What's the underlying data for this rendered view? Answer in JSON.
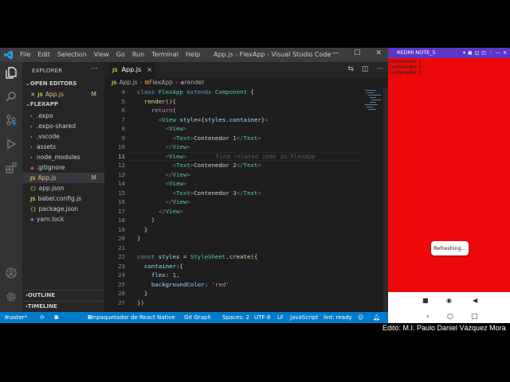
{
  "titlebar": {
    "menu": [
      "File",
      "Edit",
      "Selection",
      "View",
      "Go",
      "Run",
      "Terminal",
      "Help"
    ],
    "window_title": "App.js - FlexApp - Visual Studio Code",
    "minimize": "—",
    "maximize": "☐",
    "close": "✕"
  },
  "sidebar": {
    "title": "EXPLORER",
    "more": "···",
    "open_editors_label": "OPEN EDITORS",
    "open_editor_file": "App.js",
    "open_editor_badge": "M",
    "project_label": "FLEXAPP",
    "items": [
      {
        "label": ".expo",
        "type": "folder"
      },
      {
        "label": ".expo-shared",
        "type": "folder"
      },
      {
        "label": ".vscode",
        "type": "folder"
      },
      {
        "label": "assets",
        "type": "folder"
      },
      {
        "label": "node_modules",
        "type": "folder"
      },
      {
        "label": ".gitignore",
        "type": "file"
      },
      {
        "label": "App.js",
        "type": "file",
        "badge": "M"
      },
      {
        "label": "app.json",
        "type": "file"
      },
      {
        "label": "babel.config.js",
        "type": "file"
      },
      {
        "label": "package.json",
        "type": "file"
      },
      {
        "label": "yarn.lock",
        "type": "file"
      }
    ],
    "outline_label": "OUTLINE",
    "timeline_label": "TIMELINE"
  },
  "tabs": {
    "active": "App.js",
    "close": "×"
  },
  "breadcrumb": {
    "file": "App.js",
    "class": "FlexApp",
    "method": "render"
  },
  "editor": {
    "lines": [
      {
        "n": "4",
        "text": "class FlexApp extends Component {"
      },
      {
        "n": "5",
        "text": "  render(){"
      },
      {
        "n": "6",
        "text": "    return("
      },
      {
        "n": "7",
        "text": "      <View style={styles.container}>"
      },
      {
        "n": "8",
        "text": "        <View>"
      },
      {
        "n": "9",
        "text": "          <Text>Contenedor 1</Text>"
      },
      {
        "n": "10",
        "text": "        </View>"
      },
      {
        "n": "11",
        "text": "        <View>"
      },
      {
        "n": "12",
        "text": "          <Text>Contenedor 2</Text>"
      },
      {
        "n": "13",
        "text": "        </View>"
      },
      {
        "n": "14",
        "text": "        <View>"
      },
      {
        "n": "15",
        "text": "          <Text>Contenedor 3</Text>"
      },
      {
        "n": "16",
        "text": "        </View>"
      },
      {
        "n": "17",
        "text": "      </View>"
      },
      {
        "n": "18",
        "text": "    )"
      },
      {
        "n": "19",
        "text": "  }"
      },
      {
        "n": "20",
        "text": "}"
      },
      {
        "n": "21",
        "text": ""
      },
      {
        "n": "22",
        "text": "const styles = StyleSheet.create({"
      },
      {
        "n": "23",
        "text": "  container:{"
      },
      {
        "n": "24",
        "text": "    flex: 1,"
      },
      {
        "n": "25",
        "text": "    backgroundColor: 'red'"
      },
      {
        "n": "26",
        "text": "  }"
      },
      {
        "n": "27",
        "text": "})"
      }
    ],
    "ghost_hint": "Find related code in FlexApp"
  },
  "statusbar": {
    "branch": "master*",
    "errors": "0",
    "warnings": "0",
    "extension": "Empaquetador de React Native",
    "git_graph": "Git Graph",
    "spaces": "Spaces: 2",
    "encoding": "UTF-8",
    "eol": "LF",
    "language": "JavaScript",
    "lint": "lint: ready"
  },
  "phone": {
    "device_name": "REDMI NOTE_5",
    "containers": [
      "Contenedor 1",
      "Contenedor 2",
      "Contenedor 3"
    ],
    "toast": "Refreshing...",
    "background": "#ee0a0a"
  },
  "credit": "Editó: M.I. Paulo Daniel Vázquez Mora"
}
